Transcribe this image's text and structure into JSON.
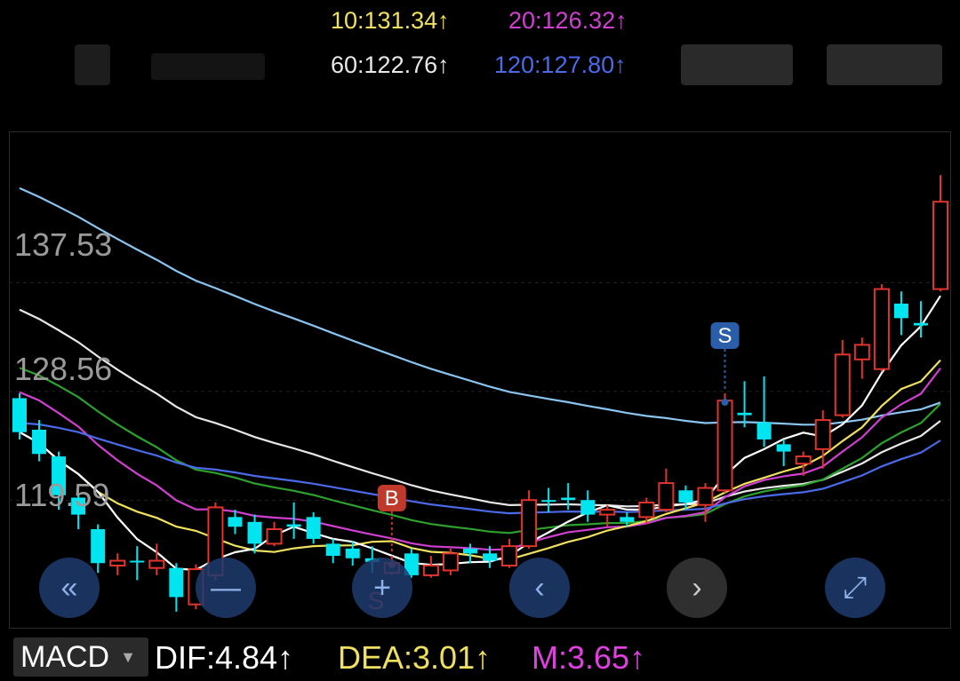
{
  "ma_legend": {
    "ma10": {
      "text": "10:131.34",
      "arrow": "↑",
      "color": "#f0e060"
    },
    "ma20": {
      "text": "20:126.32",
      "arrow": "↑",
      "color": "#d040d0"
    },
    "ma60": {
      "text": "60:122.76",
      "arrow": "↑",
      "color": "#e8e8e8"
    },
    "ma120": {
      "text": "120:127.80",
      "arrow": "↑",
      "color": "#4a6ae8"
    }
  },
  "price_labels": [
    "137.53",
    "128.56",
    "119.59"
  ],
  "controls": [
    {
      "name": "rewind-icon",
      "glyph": "«",
      "style": "blue"
    },
    {
      "name": "minus-icon",
      "glyph": "—",
      "style": "blue"
    },
    {
      "name": "plus-icon",
      "glyph": "+",
      "style": "blue"
    },
    {
      "name": "chevron-left-icon",
      "glyph": "‹",
      "style": "blue"
    },
    {
      "name": "chevron-right-icon",
      "glyph": "›",
      "style": "dark"
    },
    {
      "name": "expand-icon",
      "glyph": "⤢",
      "style": "blue"
    }
  ],
  "indicator": {
    "selector_label": "MACD",
    "dif": {
      "text": "DIF:4.84",
      "arrow": "↑",
      "color": "#ffffff"
    },
    "dea": {
      "text": "DEA:3.01",
      "arrow": "↑",
      "color": "#f0e060"
    },
    "m": {
      "text": "M:3.65",
      "arrow": "↑",
      "color": "#e040e0"
    }
  },
  "chart_data": {
    "type": "candlestick",
    "ylim": [
      109,
      150
    ],
    "candles": [
      {
        "o": 128.0,
        "c": 125.2,
        "h": 128.4,
        "l": 124.6,
        "color": "cyan"
      },
      {
        "o": 125.4,
        "c": 123.4,
        "h": 126.2,
        "l": 122.8,
        "color": "cyan"
      },
      {
        "o": 123.2,
        "c": 120.0,
        "h": 123.6,
        "l": 118.8,
        "color": "cyan"
      },
      {
        "o": 119.8,
        "c": 118.4,
        "h": 120.2,
        "l": 117.2,
        "color": "cyan"
      },
      {
        "o": 117.2,
        "c": 114.4,
        "h": 117.6,
        "l": 113.6,
        "color": "cyan"
      },
      {
        "o": 114.2,
        "c": 114.6,
        "h": 115.2,
        "l": 113.4,
        "color": "red"
      },
      {
        "o": 114.6,
        "c": 114.5,
        "h": 115.8,
        "l": 113.0,
        "color": "cyan"
      },
      {
        "o": 114.0,
        "c": 114.6,
        "h": 116.0,
        "l": 113.4,
        "color": "red"
      },
      {
        "o": 114.0,
        "c": 111.6,
        "h": 114.4,
        "l": 110.4,
        "color": "cyan"
      },
      {
        "o": 111.0,
        "c": 113.9,
        "h": 114.3,
        "l": 110.6,
        "color": "red"
      },
      {
        "o": 113.4,
        "c": 119.0,
        "h": 119.4,
        "l": 113.0,
        "color": "red"
      },
      {
        "o": 118.2,
        "c": 117.4,
        "h": 118.8,
        "l": 116.8,
        "color": "cyan"
      },
      {
        "o": 117.8,
        "c": 116.0,
        "h": 118.4,
        "l": 115.2,
        "color": "cyan"
      },
      {
        "o": 116.0,
        "c": 117.2,
        "h": 117.8,
        "l": 115.8,
        "color": "red"
      },
      {
        "o": 117.6,
        "c": 117.4,
        "h": 119.4,
        "l": 116.4,
        "color": "cyan"
      },
      {
        "o": 118.2,
        "c": 116.4,
        "h": 118.6,
        "l": 116.0,
        "color": "cyan"
      },
      {
        "o": 116.0,
        "c": 115.0,
        "h": 116.4,
        "l": 114.4,
        "color": "cyan"
      },
      {
        "o": 115.6,
        "c": 114.8,
        "h": 116.2,
        "l": 114.2,
        "color": "cyan"
      },
      {
        "o": 114.8,
        "c": 114.5,
        "h": 115.8,
        "l": 113.6,
        "color": "cyan"
      },
      {
        "o": 113.6,
        "c": 114.4,
        "h": 115.0,
        "l": 113.4,
        "color": "red"
      },
      {
        "o": 115.2,
        "c": 113.4,
        "h": 115.6,
        "l": 113.2,
        "color": "cyan"
      },
      {
        "o": 113.4,
        "c": 114.2,
        "h": 115.0,
        "l": 113.2,
        "color": "red"
      },
      {
        "o": 113.8,
        "c": 115.2,
        "h": 115.6,
        "l": 113.4,
        "color": "red"
      },
      {
        "o": 115.6,
        "c": 115.2,
        "h": 116.0,
        "l": 114.4,
        "color": "cyan"
      },
      {
        "o": 115.2,
        "c": 114.6,
        "h": 115.8,
        "l": 114.0,
        "color": "cyan"
      },
      {
        "o": 114.2,
        "c": 115.8,
        "h": 116.4,
        "l": 114.0,
        "color": "red"
      },
      {
        "o": 115.8,
        "c": 119.6,
        "h": 120.4,
        "l": 115.6,
        "color": "red"
      },
      {
        "o": 119.6,
        "c": 119.5,
        "h": 120.6,
        "l": 118.6,
        "color": "cyan"
      },
      {
        "o": 119.8,
        "c": 119.6,
        "h": 121.0,
        "l": 118.8,
        "color": "cyan"
      },
      {
        "o": 119.6,
        "c": 118.4,
        "h": 120.4,
        "l": 117.8,
        "color": "cyan"
      },
      {
        "o": 118.4,
        "c": 118.8,
        "h": 119.2,
        "l": 117.4,
        "color": "red"
      },
      {
        "o": 118.2,
        "c": 117.8,
        "h": 118.6,
        "l": 117.4,
        "color": "cyan"
      },
      {
        "o": 118.2,
        "c": 119.4,
        "h": 119.8,
        "l": 117.6,
        "color": "red"
      },
      {
        "o": 118.8,
        "c": 121.0,
        "h": 122.2,
        "l": 118.6,
        "color": "red"
      },
      {
        "o": 120.4,
        "c": 119.4,
        "h": 120.8,
        "l": 118.8,
        "color": "cyan"
      },
      {
        "o": 119.2,
        "c": 120.6,
        "h": 121.0,
        "l": 117.8,
        "color": "red"
      },
      {
        "o": 120.4,
        "c": 127.8,
        "h": 128.4,
        "l": 120.2,
        "color": "red"
      },
      {
        "o": 126.8,
        "c": 126.6,
        "h": 129.4,
        "l": 125.6,
        "color": "cyan"
      },
      {
        "o": 126.0,
        "c": 124.6,
        "h": 129.8,
        "l": 124.0,
        "color": "cyan"
      },
      {
        "o": 124.2,
        "c": 123.6,
        "h": 124.6,
        "l": 122.4,
        "color": "cyan"
      },
      {
        "o": 122.6,
        "c": 123.2,
        "h": 123.6,
        "l": 121.6,
        "color": "red"
      },
      {
        "o": 123.8,
        "c": 126.2,
        "h": 127.0,
        "l": 122.2,
        "color": "red"
      },
      {
        "o": 126.6,
        "c": 131.6,
        "h": 132.8,
        "l": 126.4,
        "color": "red"
      },
      {
        "o": 131.2,
        "c": 132.4,
        "h": 133.0,
        "l": 129.6,
        "color": "red"
      },
      {
        "o": 130.4,
        "c": 137.0,
        "h": 137.4,
        "l": 130.2,
        "color": "red"
      },
      {
        "o": 135.8,
        "c": 134.6,
        "h": 136.8,
        "l": 133.2,
        "color": "cyan"
      },
      {
        "o": 134.2,
        "c": 134.0,
        "h": 136.0,
        "l": 133.0,
        "color": "cyan"
      },
      {
        "o": 137.0,
        "c": 144.2,
        "h": 146.4,
        "l": 136.8,
        "color": "red"
      }
    ],
    "signals": [
      {
        "label": "B",
        "index": 19,
        "color": "#c0392b",
        "above": true
      },
      {
        "label": "S",
        "index": 36,
        "color": "#2a5ea8",
        "above": true
      },
      {
        "label": "S",
        "index": 19,
        "color": "#c0392b",
        "above": false
      }
    ]
  }
}
